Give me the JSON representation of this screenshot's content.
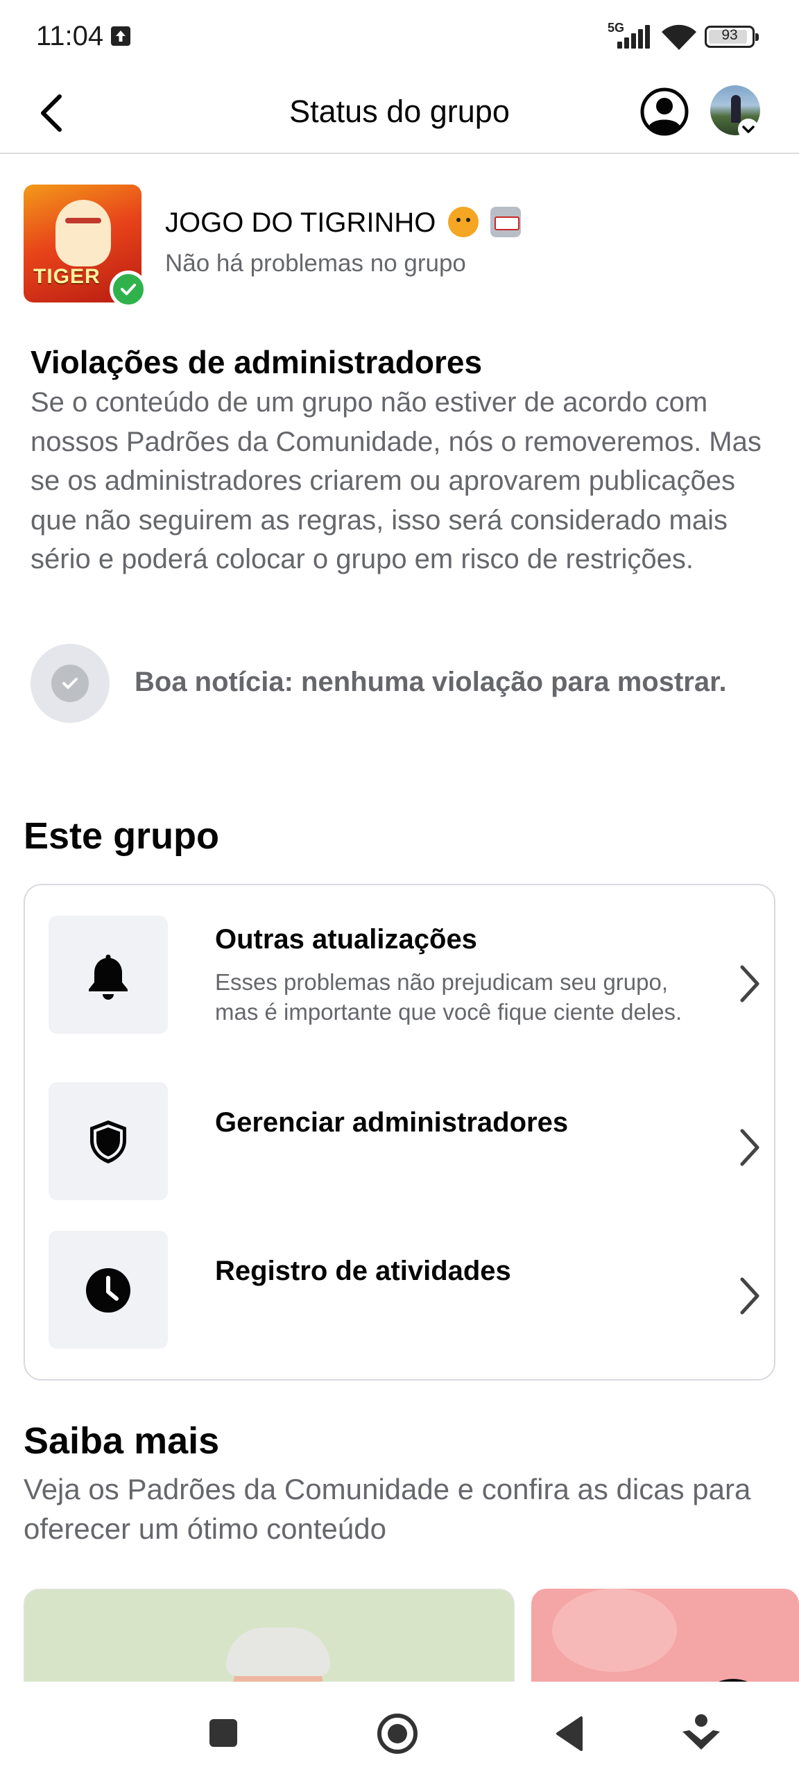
{
  "status_bar": {
    "time": "11:04",
    "network": "5G",
    "battery": "93",
    "battery_level": 0.93
  },
  "header": {
    "title": "Status do grupo",
    "back_icon": "chevron-left-icon",
    "profile_icon": "account-circle-icon"
  },
  "group": {
    "name": "JOGO DO TIGRINHO",
    "status": "Não há problemas no grupo",
    "thumbnail_text": "TIGER"
  },
  "violations": {
    "title": "Violações de administradores",
    "description": "Se o conteúdo de um grupo não estiver de acordo com nossos Padrões da Comunidade, nós o removeremos. Mas se os administradores criarem ou aprovarem publicações que não seguirem as regras, isso será considerado mais sério e poderá colocar o grupo em risco de restrições.",
    "empty_message": "Boa notícia: nenhuma violação para mostrar."
  },
  "este_grupo": {
    "title": "Este grupo",
    "items": [
      {
        "title": "Outras atualizações",
        "subtitle": "Esses problemas não prejudicam seu grupo, mas é importante que você fique ciente deles.",
        "icon": "bell-icon"
      },
      {
        "title": "Gerenciar administradores",
        "subtitle": "",
        "icon": "shield-icon"
      },
      {
        "title": "Registro de atividades",
        "subtitle": "",
        "icon": "clock-icon"
      }
    ]
  },
  "saiba_mais": {
    "title": "Saiba mais",
    "description": "Veja os Padrões da Comunidade e confira as dicas para oferecer um ótimo conteúdo"
  },
  "colors": {
    "text_primary": "#050505",
    "text_secondary": "#65676b",
    "icon_bg": "#f0f2f5",
    "success_green": "#2fb24b",
    "divider": "#dcdde0"
  }
}
